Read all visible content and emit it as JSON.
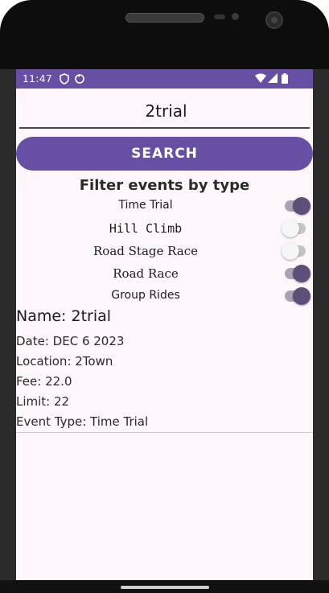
{
  "status_bar": {
    "time": "11:47",
    "background": "#6750a4"
  },
  "search": {
    "value": "2trial",
    "button_label": "SEARCH"
  },
  "filter": {
    "heading": "Filter events by type",
    "options": [
      {
        "label": "Time Trial",
        "enabled": true
      },
      {
        "label": "Hill Climb",
        "enabled": false
      },
      {
        "label": "Road Stage Race",
        "enabled": false
      },
      {
        "label": "Road Race",
        "enabled": true
      },
      {
        "label": "Group Rides",
        "enabled": true
      }
    ]
  },
  "event": {
    "name": "Name: 2trial",
    "date": "Date: DEC 6 2023",
    "location": "Location: 2Town",
    "fee": "Fee: 22.0",
    "limit": "Limit: 22",
    "type": "Event Type: Time Trial"
  },
  "colors": {
    "accent": "#6750a4",
    "screen_bg": "#fdf7fb",
    "switch_on_thumb": "#5c4f7a"
  },
  "icons": [
    "shield-icon",
    "sync-icon",
    "wifi-icon",
    "cell-signal-icon",
    "battery-icon"
  ]
}
